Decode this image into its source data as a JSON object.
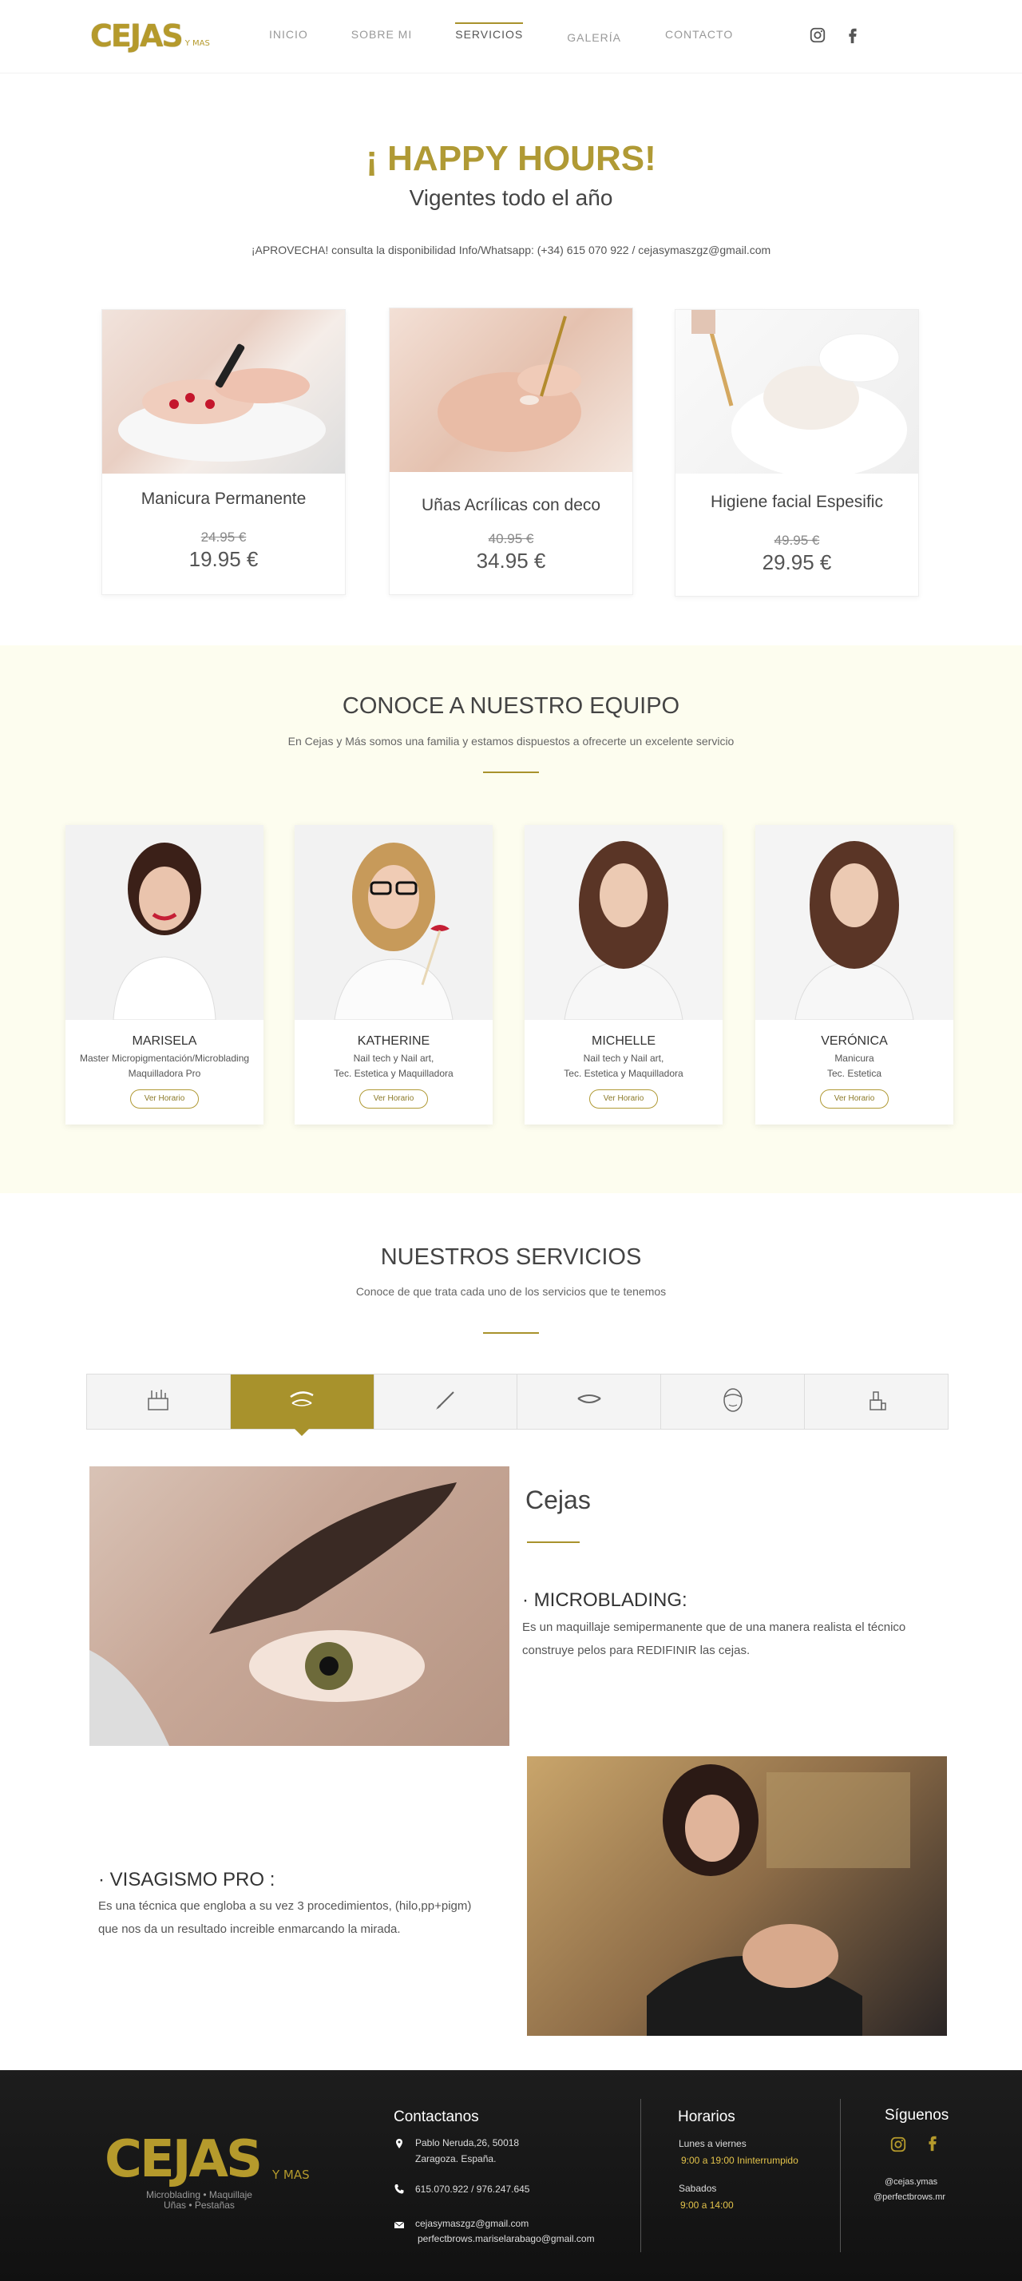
{
  "header": {
    "logo_main": "CEJAS",
    "logo_small": "Y MAS",
    "nav": [
      {
        "label": "INICIO"
      },
      {
        "label": "SOBRE MI"
      },
      {
        "label": "SERVICIOS"
      },
      {
        "label": "GALERÍA"
      },
      {
        "label": "CONTACTO"
      }
    ],
    "icons": [
      "instagram-icon",
      "facebook-icon"
    ]
  },
  "happy_hours": {
    "title": "¡ HAPPY HOURS!",
    "subtitle": "Vigentes todo el año",
    "info": "¡APROVECHA! consulta la disponibilidad Info/Whatsapp: (+34) 615 070 922 / cejasymaszgz@gmail.com",
    "promos": [
      {
        "name": "Manicura Permanente",
        "old_price": "24.95 €",
        "new_price": "19.95 €"
      },
      {
        "name": "Uñas Acrílicas con deco",
        "old_price": "40.95 €",
        "new_price": "34.95 €"
      },
      {
        "name": "Higiene facial Espesific",
        "old_price": "49.95 €",
        "new_price": "29.95 €"
      }
    ]
  },
  "team": {
    "title": "CONOCE A NUESTRO EQUIPO",
    "subtitle": "En Cejas y Más somos una familia y estamos dispuestos a ofrecerte un excelente servicio",
    "members": [
      {
        "name": "MARISELA",
        "role1": "Master Micropigmentación/Microblading",
        "role2": "Maquilladora Pro",
        "button": "Ver Horario"
      },
      {
        "name": "KATHERINE",
        "role1": "Nail tech y Nail art,",
        "role2": "Tec. Estetica y Maquilladora",
        "button": "Ver Horario"
      },
      {
        "name": "MICHELLE",
        "role1": "Nail tech y Nail art,",
        "role2": "Tec. Estetica y Maquilladora",
        "button": "Ver Horario"
      },
      {
        "name": "VERÓNICA",
        "role1": "Manicura",
        "role2": "Tec. Estetica",
        "button": "Ver Horario"
      }
    ]
  },
  "services": {
    "title": "NUESTROS SERVICIOS",
    "subtitle": "Conoce de que trata cada uno de los servicios que te tenemos",
    "tabs": [
      "makeup-kit-icon",
      "eyebrow-icon",
      "brush-icon",
      "eyelash-icon",
      "face-mask-icon",
      "nail-polish-icon"
    ],
    "active_tab": 1,
    "panel_title": "Cejas",
    "item1_title": "· MICROBLADING:",
    "item1_line1": "Es un maquillaje semipermanente que de una manera realista el técnico",
    "item1_line2": "construye pelos para REDIFINIR las cejas.",
    "item2_title": "· VISAGISMO PRO :",
    "item2_line1": "Es una técnica que engloba a su vez 3 procedimientos, (hilo,pp+pigm)",
    "item2_line2": "que nos da un resultado increible enmarcando la mirada."
  },
  "footer": {
    "logo_main": "CEJAS",
    "logo_small": "Y MAS",
    "logo_tag1": "Microblading • Maquillaje",
    "logo_tag2": "Uñas • Pestañas",
    "contact_title": "Contactanos",
    "address1": "Pablo Neruda,26, 50018",
    "address2": "Zaragoza. España.",
    "phone": "615.070.922 / 976.247.645",
    "email1": "cejasymaszgz@gmail.com",
    "email2": "perfectbrows.mariselarabago@gmail.com",
    "hours_title": "Horarios",
    "weekdays": "Lunes a viernes",
    "weekdays_hours": "9:00 a 19:00  Ininterrumpido",
    "saturday": "Sabados",
    "saturday_hours": "9:00 a 14:00",
    "follow_title": "Síguenos",
    "handle1": "@cejas.ymas",
    "handle2": "@perfectbrows.mr"
  }
}
